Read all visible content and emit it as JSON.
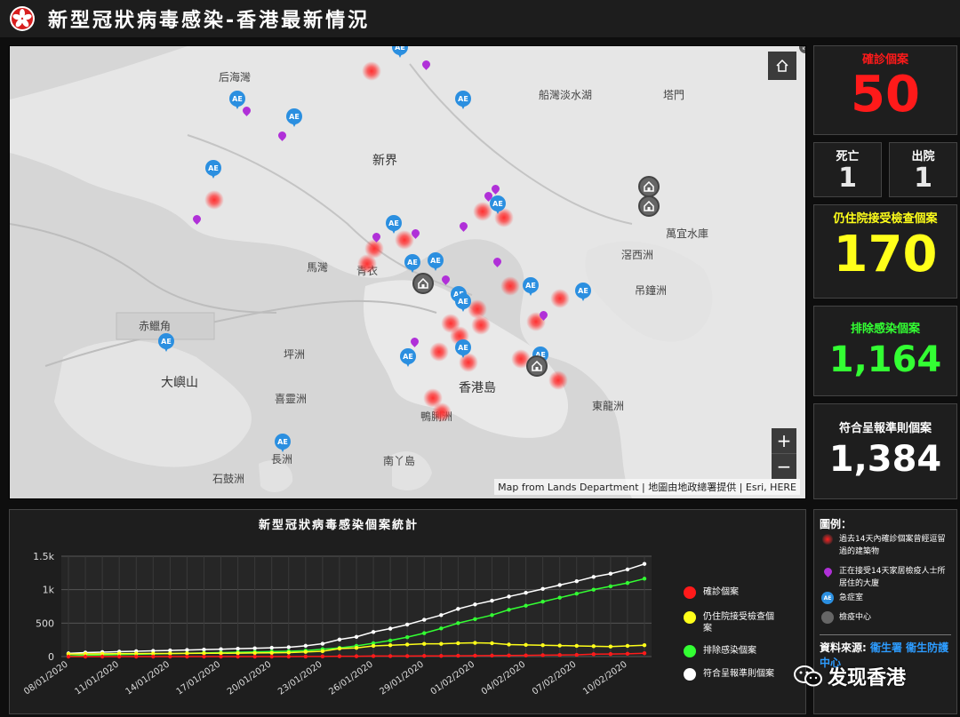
{
  "header": {
    "title": "新型冠狀病毒感染-香港最新情況"
  },
  "map": {
    "labels": {
      "hau_hoi_wan": "后海灣",
      "san_tin": "新界",
      "tsing_yi": "青衣",
      "ma_wan": "馬灣",
      "chek_lap_kok": "赤鱲角",
      "lantau": "大嶼山",
      "peng_chau": "坪洲",
      "hei_ling_chau": "喜靈洲",
      "cheung_chau": "長洲",
      "shek_kwu_chau": "石鼓洲",
      "lamma": "南丫島",
      "hk_island": "香港島",
      "ap_lei_chau": "鴨脷洲",
      "tung_lung": "東龍洲",
      "kau_sai": "滘西洲",
      "tiu_chung": "吊鐘洲",
      "high_island": "萬宜水庫",
      "tolo": "船灣淡水湖",
      "tap_mun": "塔門"
    },
    "credit": "Map from Lands Department | 地圖由地政總署提供 | Esri, HERE",
    "ae_text": "AE",
    "home_icon": "home-icon",
    "zoom_in": "+",
    "zoom_out": "−"
  },
  "stats": {
    "confirmed": {
      "label": "確診個案",
      "value": "50",
      "color": "#ff1a1a"
    },
    "death": {
      "label": "死亡",
      "value": "1"
    },
    "discharged": {
      "label": "出院",
      "value": "1"
    },
    "hospitalised": {
      "label": "仍住院接受檢查個案",
      "value": "170",
      "color": "#ffff1a"
    },
    "excluded": {
      "label": "排除感染個案",
      "value": "1,164",
      "color": "#33ff33"
    },
    "reported": {
      "label": "符合呈報準則個案",
      "value": "1,384",
      "color": "#ffffff"
    }
  },
  "chart_panel": {
    "title": "新型冠狀病毒感染個案統計",
    "legend": [
      {
        "name": "確診個案",
        "color": "#ff1a1a"
      },
      {
        "name": "仍住院接受檢查個案",
        "color": "#ffff1a"
      },
      {
        "name": "排除感染個案",
        "color": "#33ff33"
      },
      {
        "name": "符合呈報準則個案",
        "color": "#ffffff"
      }
    ]
  },
  "chart_data": {
    "type": "line",
    "x_tick_labels": [
      "08/01/2020",
      "11/01/2020",
      "14/01/2020",
      "17/01/2020",
      "20/01/2020",
      "23/01/2020",
      "26/01/2020",
      "29/01/2020",
      "01/02/2020",
      "04/02/2020",
      "07/02/2020",
      "10/02/2020"
    ],
    "y_tick_labels": [
      "0",
      "500",
      "1k",
      "1.5k"
    ],
    "ylim": [
      0,
      1500
    ],
    "x": [
      "08/01",
      "09/01",
      "10/01",
      "11/01",
      "12/01",
      "13/01",
      "14/01",
      "15/01",
      "16/01",
      "17/01",
      "18/01",
      "19/01",
      "20/01",
      "21/01",
      "22/01",
      "23/01",
      "24/01",
      "25/01",
      "26/01",
      "27/01",
      "28/01",
      "29/01",
      "30/01",
      "31/01",
      "01/02",
      "02/02",
      "03/02",
      "04/02",
      "05/02",
      "06/02",
      "07/02",
      "08/02",
      "09/02",
      "10/02",
      "11/02"
    ],
    "series": [
      {
        "name": "確診個案",
        "color": "#ff1a1a",
        "values": [
          0,
          0,
          0,
          0,
          0,
          0,
          0,
          0,
          0,
          0,
          0,
          0,
          0,
          0,
          1,
          2,
          5,
          5,
          8,
          8,
          8,
          10,
          10,
          12,
          14,
          15,
          17,
          18,
          21,
          24,
          26,
          36,
          38,
          42,
          50
        ]
      },
      {
        "name": "仍住院接受檢查個案",
        "color": "#ffff1a",
        "values": [
          38,
          40,
          42,
          44,
          45,
          46,
          47,
          48,
          49,
          50,
          52,
          54,
          56,
          60,
          70,
          80,
          120,
          130,
          160,
          170,
          180,
          190,
          190,
          200,
          205,
          200,
          180,
          175,
          170,
          165,
          160,
          155,
          150,
          160,
          170
        ]
      },
      {
        "name": "排除感染個案",
        "color": "#33ff33",
        "values": [
          10,
          20,
          25,
          30,
          35,
          40,
          45,
          50,
          55,
          60,
          65,
          70,
          75,
          80,
          90,
          110,
          130,
          160,
          200,
          240,
          290,
          350,
          420,
          500,
          560,
          620,
          700,
          760,
          820,
          880,
          940,
          1000,
          1050,
          1100,
          1164
        ]
      },
      {
        "name": "符合呈報準則個案",
        "color": "#ffffff",
        "values": [
          48,
          60,
          67,
          74,
          80,
          86,
          92,
          98,
          104,
          110,
          117,
          124,
          131,
          140,
          161,
          192,
          255,
          295,
          368,
          418,
          478,
          550,
          620,
          712,
          779,
          835,
          897,
          953,
          1011,
          1069,
          1126,
          1191,
          1238,
          1302,
          1384
        ]
      }
    ]
  },
  "side_legend": {
    "title": "圖例：",
    "items": [
      {
        "text": "過去14天內確診個案曾經逗留過的建築物",
        "icon": "hotspot-icon"
      },
      {
        "text": "正在接受14天家居檢疫人士所居住的大廈",
        "icon": "purple-pin-icon"
      },
      {
        "text": "急症室",
        "icon": "ae-pin-icon"
      },
      {
        "text": "檢疫中心",
        "icon": "quarantine-icon"
      }
    ],
    "source_label": "資料來源:",
    "source_link": "衞生署 衞生防護中心"
  },
  "watermark": {
    "text": "发现香港"
  }
}
